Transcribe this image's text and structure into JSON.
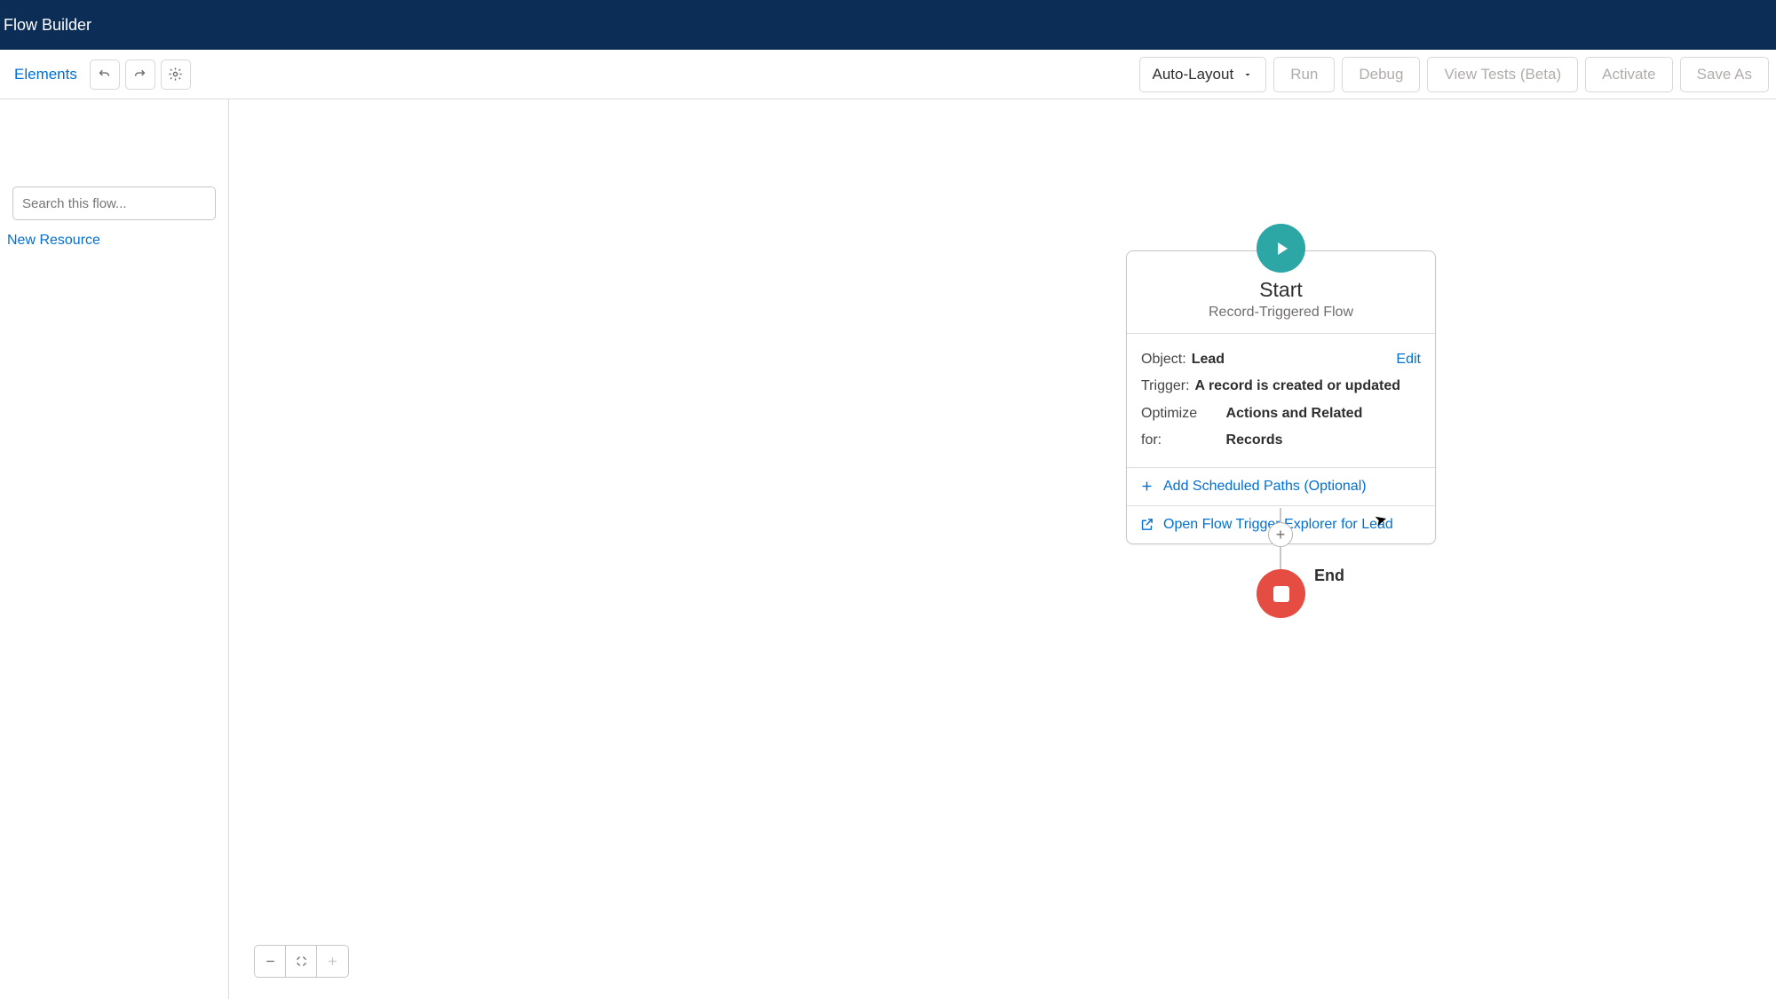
{
  "header": {
    "app_title": "Flow Builder"
  },
  "toolbar": {
    "elements_link": "Elements",
    "layout_dropdown": "Auto-Layout",
    "buttons": {
      "run": "Run",
      "debug": "Debug",
      "view_tests": "View Tests (Beta)",
      "activate": "Activate",
      "save_as": "Save As"
    }
  },
  "sidebar": {
    "search_placeholder": "Search this flow...",
    "new_resource": "New Resource"
  },
  "canvas": {
    "start": {
      "title": "Start",
      "subtitle": "Record-Triggered Flow",
      "edit": "Edit",
      "rows": {
        "object": {
          "label": "Object:",
          "value": "Lead"
        },
        "trigger": {
          "label": "Trigger:",
          "value": "A record is created or updated"
        },
        "optimize": {
          "label": "Optimize for:",
          "value": "Actions and Related Records"
        }
      },
      "scheduled_paths": "Add Scheduled Paths (Optional)",
      "explorer": "Open Flow Trigger Explorer for Lead"
    },
    "end_label": "End"
  }
}
